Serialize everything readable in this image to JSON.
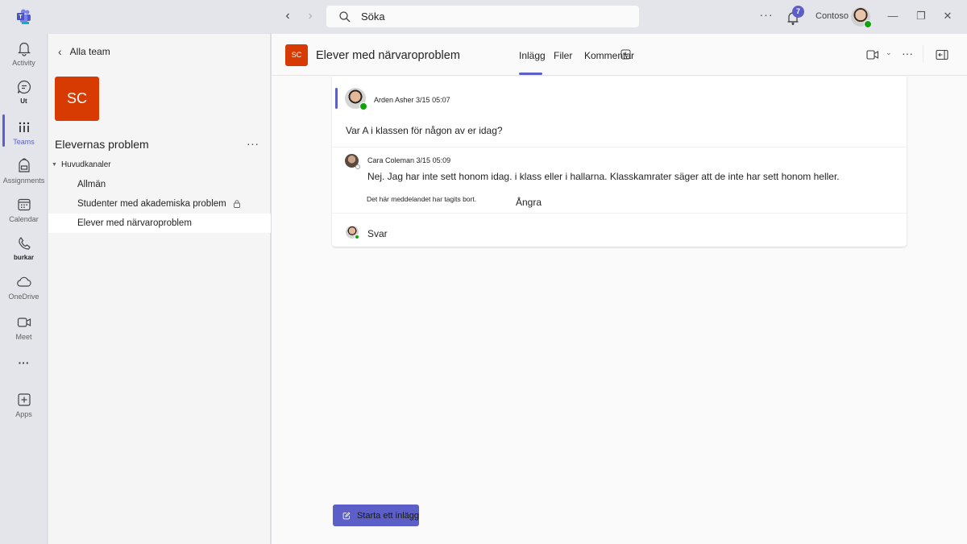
{
  "titlebar": {
    "search_placeholder": "Söka",
    "more_label": "···",
    "notification_count": "7",
    "org_name": "Contoso",
    "back_label": "‹",
    "forward_label": "›",
    "minimize_label": "—",
    "maximize_label": "❐",
    "close_label": "✕"
  },
  "rail": {
    "items": [
      {
        "label": "Activity",
        "icon": "bell-icon"
      },
      {
        "label": "Ut",
        "icon": "chat-icon"
      },
      {
        "label": "Teams",
        "icon": "teams-icon",
        "active": true
      },
      {
        "label": "Assignments",
        "icon": "backpack-icon"
      },
      {
        "label": "Calendar",
        "icon": "calendar-icon"
      },
      {
        "label": "burkar",
        "icon": "phone-icon"
      },
      {
        "label": "OneDrive",
        "icon": "cloud-icon"
      },
      {
        "label": "Meet",
        "icon": "video-icon"
      },
      {
        "label": "···",
        "icon": "more-icon"
      },
      {
        "label": "Apps",
        "icon": "add-app-icon"
      }
    ]
  },
  "panel": {
    "back_label": "Alla team",
    "team_initials": "SC",
    "team_name": "Elevernas problem",
    "team_more": "···",
    "section_label": "Huvudkanaler",
    "channels": [
      {
        "name": "Allmän",
        "locked": false,
        "selected": false
      },
      {
        "name": "Studenter med akademiska problem",
        "locked": true,
        "selected": false
      },
      {
        "name": "Elever med närvaroproblem",
        "locked": false,
        "selected": true
      }
    ]
  },
  "channel_header": {
    "initials": "SC",
    "title": "Elever med närvaroproblem",
    "tabs": [
      {
        "label": "Inlägg",
        "active": true
      },
      {
        "label": "Filer",
        "active": false
      },
      {
        "label": "Kommentar",
        "active": false
      }
    ],
    "caret": "⌄",
    "more": "···"
  },
  "thread": {
    "post": {
      "author": "Arden Asher",
      "timestamp": "3/15 05:07",
      "body": "Var A i klassen för någon av er idag?"
    },
    "reply": {
      "author": "Cara Coleman",
      "timestamp": "3/15 05:09",
      "body": "Nej. Jag har inte sett honom idag. i klass eller i hallarna. Klasskamrater säger att de inte har sett honom heller."
    },
    "deleted_note": "Det här meddelandet har tagits bort.",
    "undo_label": "Ångra",
    "reply_placeholder": "Svar"
  },
  "new_post_label": "Starta ett inlägg",
  "colors": {
    "accent": "#5b5fc7",
    "team_tile": "#d83b01",
    "presence_available": "#13a10e"
  }
}
